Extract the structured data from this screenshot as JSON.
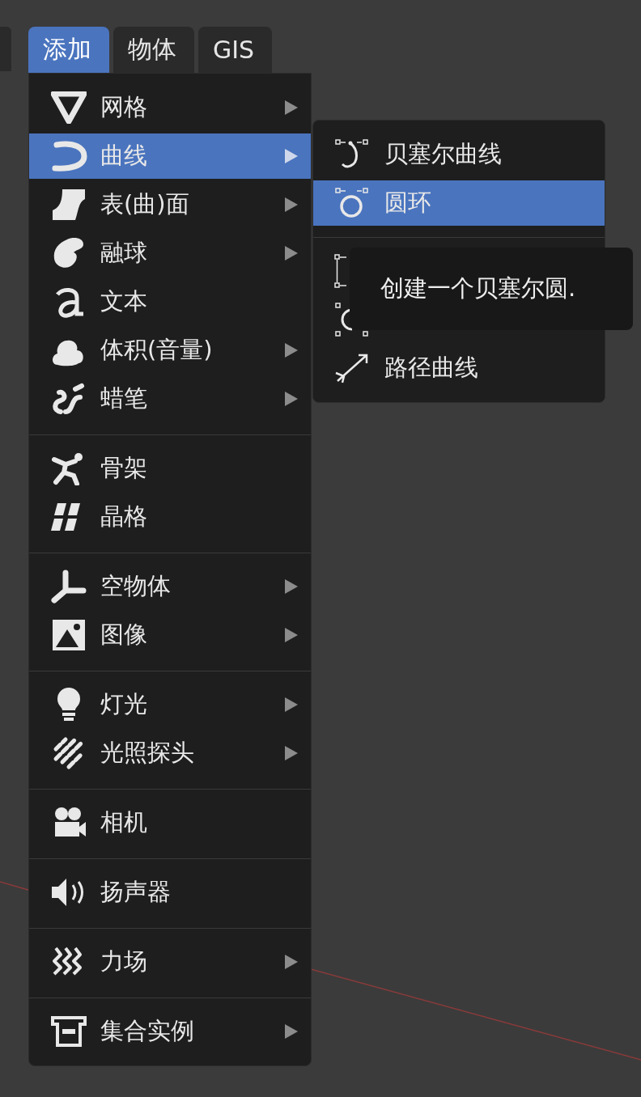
{
  "menubar": {
    "tabs": [
      {
        "label": "添加",
        "selected": true
      },
      {
        "label": "物体",
        "selected": false
      },
      {
        "label": "GIS",
        "selected": false
      }
    ]
  },
  "add_menu": {
    "groups": [
      [
        {
          "label": "网格",
          "submenu": true,
          "selected": false
        },
        {
          "label": "曲线",
          "submenu": true,
          "selected": true
        },
        {
          "label": "表(曲)面",
          "submenu": true,
          "selected": false
        },
        {
          "label": "融球",
          "submenu": true,
          "selected": false
        },
        {
          "label": "文本",
          "submenu": false,
          "selected": false
        },
        {
          "label": "体积(音量)",
          "submenu": true,
          "selected": false
        },
        {
          "label": "蜡笔",
          "submenu": true,
          "selected": false
        }
      ],
      [
        {
          "label": "骨架",
          "submenu": false,
          "selected": false
        },
        {
          "label": "晶格",
          "submenu": false,
          "selected": false
        }
      ],
      [
        {
          "label": "空物体",
          "submenu": true,
          "selected": false
        },
        {
          "label": "图像",
          "submenu": true,
          "selected": false
        }
      ],
      [
        {
          "label": "灯光",
          "submenu": true,
          "selected": false
        },
        {
          "label": "光照探头",
          "submenu": true,
          "selected": false
        }
      ],
      [
        {
          "label": "相机",
          "submenu": false,
          "selected": false
        }
      ],
      [
        {
          "label": "扬声器",
          "submenu": false,
          "selected": false
        }
      ],
      [
        {
          "label": "力场",
          "submenu": true,
          "selected": false
        }
      ],
      [
        {
          "label": "集合实例",
          "submenu": true,
          "selected": false
        }
      ]
    ]
  },
  "curve_submenu": {
    "groups": [
      [
        {
          "label": "贝塞尔曲线",
          "selected": false
        },
        {
          "label": "圆环",
          "selected": true
        }
      ],
      [
        {
          "selected": false
        },
        {
          "selected": false
        },
        {
          "label": "路径曲线",
          "selected": false
        }
      ]
    ]
  },
  "tooltip": {
    "text": "创建一个贝塞尔圆."
  }
}
